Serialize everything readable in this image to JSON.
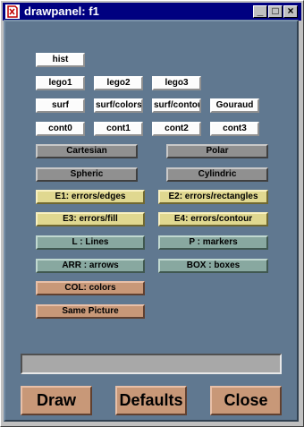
{
  "window": {
    "title": "drawpanel: f1",
    "controls": {
      "minimize": "_",
      "maximize": "□",
      "close": "×"
    }
  },
  "buttons": {
    "hist": "hist",
    "lego1": "lego1",
    "lego2": "lego2",
    "lego3": "lego3",
    "surf": "surf",
    "surf_colors": "surf/colors",
    "surf_contour": "surf/contour",
    "gouraud": "Gouraud",
    "cont0": "cont0",
    "cont1": "cont1",
    "cont2": "cont2",
    "cont3": "cont3",
    "cartesian": "Cartesian",
    "polar": "Polar",
    "spheric": "Spheric",
    "cylindric": "Cylindric",
    "e1": "E1: errors/edges",
    "e2": "E2: errors/rectangles",
    "e3": "E3: errors/fill",
    "e4": "E4: errors/contour",
    "lines": "L : Lines",
    "markers": "P : markers",
    "arrows": "ARR : arrows",
    "boxes": "BOX : boxes",
    "colors": "COL: colors",
    "same_picture": "Same Picture"
  },
  "actions": {
    "draw": "Draw",
    "defaults": "Defaults",
    "close": "Close"
  },
  "colors": {
    "panel": "#607890",
    "white_btn": "#fcfcfc",
    "gray_btn": "#909090",
    "yellow_btn": "#e0d890",
    "teal_btn": "#88a8a0",
    "orange_btn": "#c89878",
    "titlebar": "#000080"
  }
}
